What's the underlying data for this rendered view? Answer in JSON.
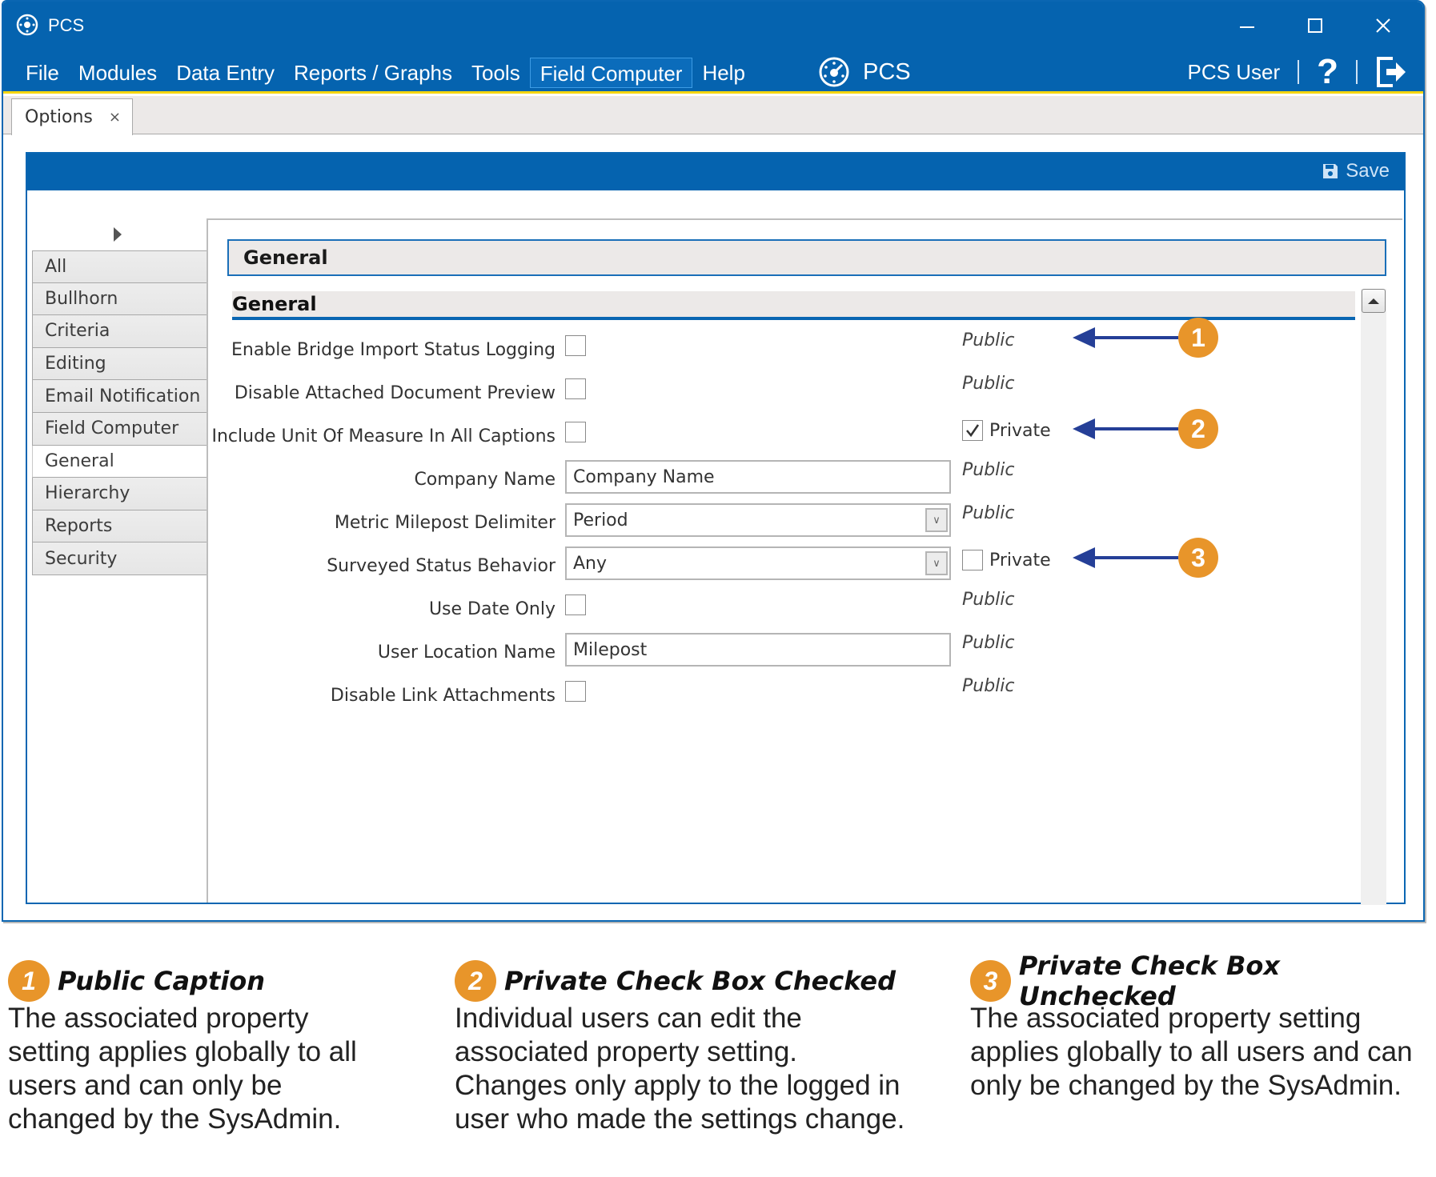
{
  "window": {
    "title": "PCS",
    "controls": {
      "minimize": "—",
      "maximize": "☐",
      "close": "✕"
    }
  },
  "menubar": {
    "items": [
      "File",
      "Modules",
      "Data Entry",
      "Reports / Graphs",
      "Tools",
      "Field Computer",
      "Help"
    ],
    "active_item": "Field Computer",
    "brand_label": "PCS",
    "user_label": "PCS User",
    "help_label": "?"
  },
  "tabs": [
    {
      "label": "Options",
      "close": "×"
    }
  ],
  "toolbar": {
    "save_label": "Save"
  },
  "sidebar": {
    "items": [
      "All",
      "Bullhorn",
      "Criteria",
      "Editing",
      "Email Notification",
      "Field Computer",
      "General",
      "Hierarchy",
      "Reports",
      "Security"
    ],
    "active": "General"
  },
  "content": {
    "page_title": "General",
    "section_title": "General",
    "rows": [
      {
        "label": "Enable Bridge Import Status Logging",
        "control": "checkbox",
        "checked": false,
        "scope": "Public",
        "callout": "1"
      },
      {
        "label": "Disable Attached Document Preview",
        "control": "checkbox",
        "checked": false,
        "scope": "Public"
      },
      {
        "label": "Include Unit Of Measure In All Captions",
        "control": "checkbox",
        "checked": false,
        "scope": "Private",
        "private_checked": true,
        "callout": "2"
      },
      {
        "label": "Company Name",
        "control": "text",
        "value": "Company Name",
        "scope": "Public"
      },
      {
        "label": "Metric Milepost Delimiter",
        "control": "select",
        "value": "Period",
        "scope": "Public"
      },
      {
        "label": "Surveyed Status Behavior",
        "control": "select",
        "value": "Any",
        "scope": "Private",
        "private_checked": false,
        "callout": "3"
      },
      {
        "label": "Use Date Only",
        "control": "checkbox",
        "checked": false,
        "scope": "Public"
      },
      {
        "label": "User Location Name",
        "control": "text",
        "value": "Milepost",
        "scope": "Public"
      },
      {
        "label": "Disable Link Attachments",
        "control": "checkbox",
        "checked": false,
        "scope": "Public"
      }
    ]
  },
  "legend": [
    {
      "number": "1",
      "title": "Public Caption",
      "body": [
        "The associated property",
        "setting applies globally to all",
        "users and can only be",
        "changed by the SysAdmin."
      ]
    },
    {
      "number": "2",
      "title": "Private Check Box Checked",
      "body": [
        "Individual users can edit the",
        "associated property setting.",
        "Changes only apply to the logged in",
        "user who made the settings change."
      ]
    },
    {
      "number": "3",
      "title": "Private Check Box Unchecked",
      "body": [
        "The associated property setting",
        "applies globally to all users and can",
        "only be changed by the SysAdmin."
      ]
    }
  ],
  "colors": {
    "brand_blue": "#0563af",
    "accent_yellow": "#f6d60e",
    "callout_orange": "#e8952a",
    "arrow_blue": "#253f97"
  }
}
